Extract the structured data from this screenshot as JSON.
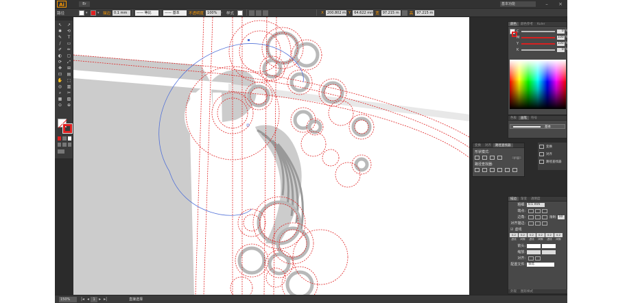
{
  "app": {
    "logo": "Ai",
    "bridge_label": "Br",
    "workspace": "基本功能",
    "minimize": "–",
    "close": "×"
  },
  "control_bar": {
    "selection": "路径",
    "stroke_label": "描边",
    "stroke_weight": "0.1 mm",
    "profile": "等比",
    "brush": "基本",
    "opacity_label": "不透明度",
    "opacity_value": "100%",
    "style_label": "样式",
    "x_label": "X",
    "x_value": "200.802 m",
    "y_label": "Y",
    "y_value": "64.622 mm",
    "w_label": "宽",
    "w_value": "97.215 m",
    "h_label": "高",
    "h_value": "97.215 m"
  },
  "tools": [
    "↖",
    "↗",
    "✱",
    "⟲",
    "✎",
    "T",
    "/",
    "▭",
    "✐",
    "✏",
    "◐",
    "▢",
    "⟳",
    "⤢",
    "✥",
    "⊞",
    "⊡",
    "▤",
    "✋",
    "⬚",
    "◎",
    "▥",
    "⌕",
    "✂",
    "▦",
    "▧",
    "⊙",
    "⊕"
  ],
  "color_panel": {
    "tabs": [
      "颜色",
      "颜色参考",
      "Kuler"
    ],
    "channels": [
      {
        "label": "C",
        "value": "0",
        "fill": 0
      },
      {
        "label": "M",
        "value": "100",
        "fill": 1.0
      },
      {
        "label": "Y",
        "value": "100",
        "fill": 1.0
      },
      {
        "label": "K",
        "value": "0",
        "fill": 0
      }
    ],
    "unit": "%"
  },
  "brushes_panel": {
    "tabs": [
      "色板",
      "画笔",
      "符号"
    ],
    "brush_name": "基本"
  },
  "pathfinder_panel": {
    "tabs": [
      "变换",
      "对齐",
      "路径查找器"
    ],
    "shape_modes_label": "形状模式:",
    "expand_label": "扩展",
    "pathfinders_label": "路径查找器:"
  },
  "side_list": {
    "items": [
      "变换",
      "对齐",
      "路径查找器"
    ]
  },
  "stroke_panel": {
    "tabs": [
      "描边",
      "渐变",
      "透明度"
    ],
    "weight_label": "粗细:",
    "weight_value": "0.1 mm",
    "cap_label": "端点:",
    "corner_label": "边角:",
    "limit_label": "限制:",
    "limit_value": "10",
    "align_label": "对齐描边:",
    "dashed_label": "虚线",
    "dash_values": [
      "0.2",
      "0.2",
      "0.2",
      "0.2",
      "0.2",
      "0.2"
    ],
    "dash_labels": [
      "虚线",
      "间隙",
      "虚线",
      "间隙",
      "虚线",
      "间隙"
    ],
    "arrow_label": "箭头:",
    "scale_label": "缩放:",
    "align_arrow_label": "对齐:",
    "profile_label": "配置文件:",
    "profile_value": "等比",
    "footer_tabs": [
      "外观",
      "图形样式"
    ]
  },
  "status_bar": {
    "zoom": "150%",
    "page": "1",
    "tool": "直接选择"
  },
  "colors": {
    "accent": "#ff9a00",
    "guide": "#e02020",
    "path": "#5070d8",
    "shape": "#cccccc"
  }
}
